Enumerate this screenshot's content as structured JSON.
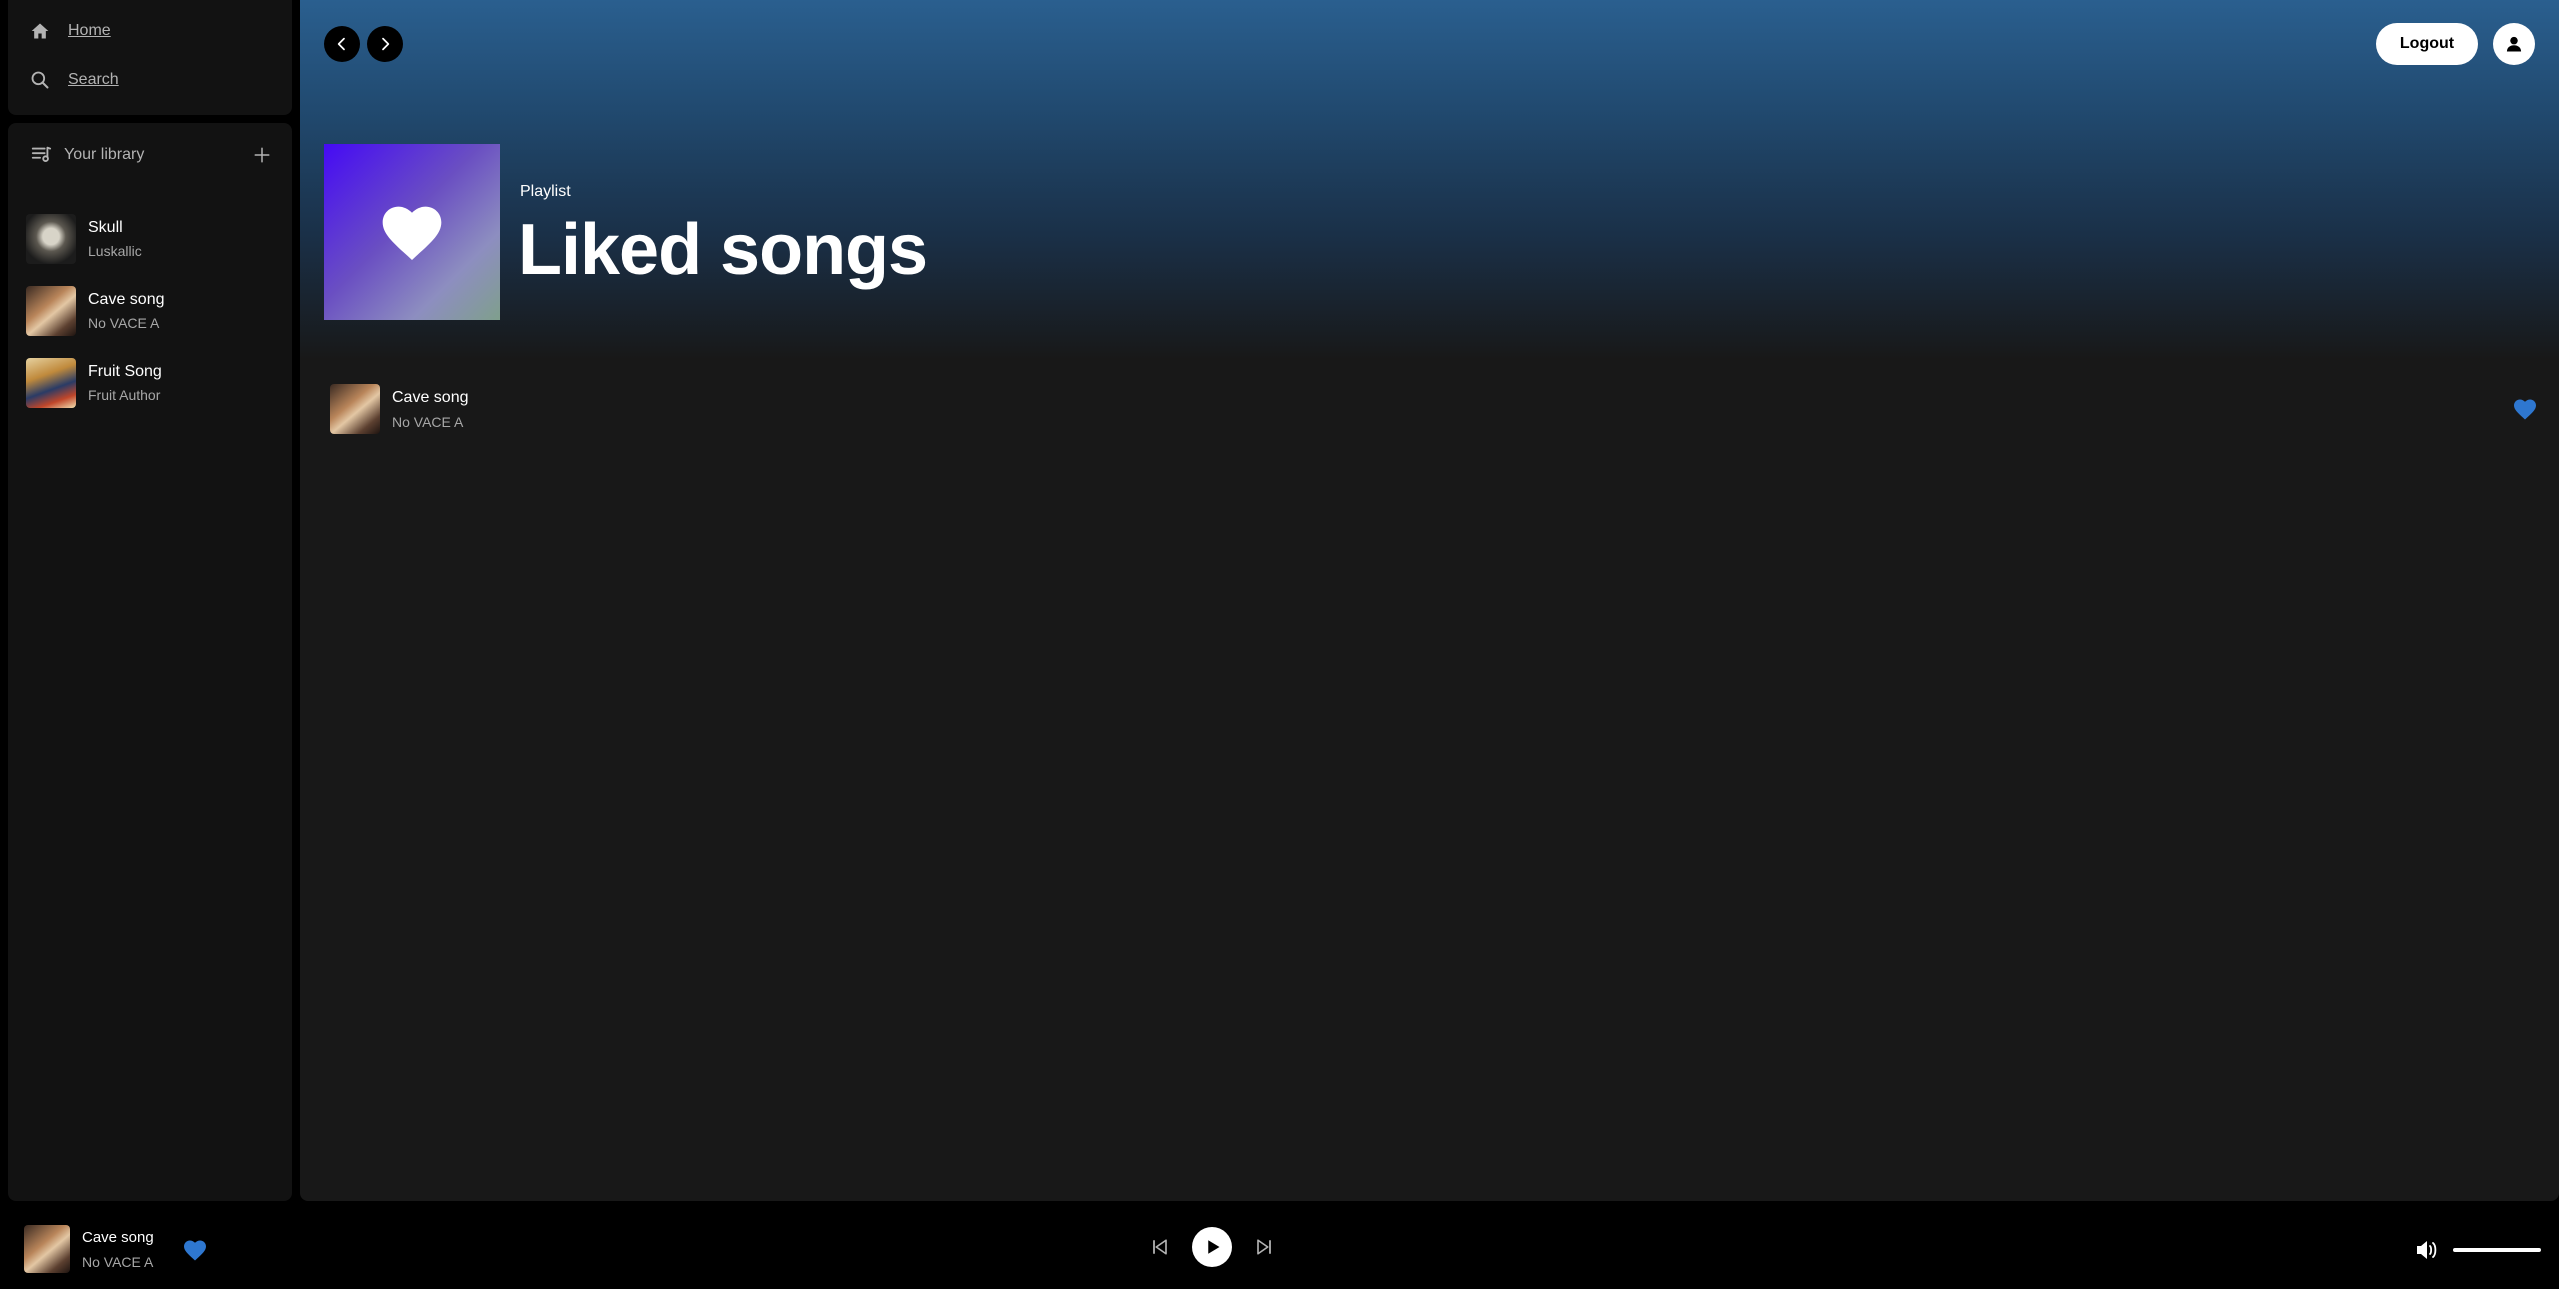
{
  "nav": {
    "home_label": "Home",
    "search_label": "Search"
  },
  "library": {
    "title": "Your library",
    "items": [
      {
        "name": "Skull",
        "artist": "Luskallic",
        "thumb": "skull-cover"
      },
      {
        "name": "Cave song",
        "artist": "No VACE A",
        "thumb": "cave-cover"
      },
      {
        "name": "Fruit Song",
        "artist": "Fruit Author",
        "thumb": "fruit-cover"
      }
    ]
  },
  "header": {
    "logout_label": "Logout"
  },
  "playlist": {
    "type_label": "Playlist",
    "title": "Liked songs",
    "tracks": [
      {
        "name": "Cave song",
        "artist": "No VACE A",
        "liked": true
      }
    ]
  },
  "player": {
    "now_playing": {
      "name": "Cave song",
      "artist": "No VACE A",
      "liked": true
    },
    "volume_level": 1.0
  },
  "colors": {
    "accent_blue": "#2e77d0",
    "background": "#181818",
    "panel": "#121212",
    "cover_start": "#450af5",
    "cover_end": "#7f9f8c"
  },
  "icons": [
    "home-icon",
    "search-icon",
    "library-icon",
    "plus-icon",
    "chevron-left-icon",
    "chevron-right-icon",
    "user-icon",
    "heart-icon",
    "previous-icon",
    "play-icon",
    "next-icon",
    "volume-icon"
  ]
}
